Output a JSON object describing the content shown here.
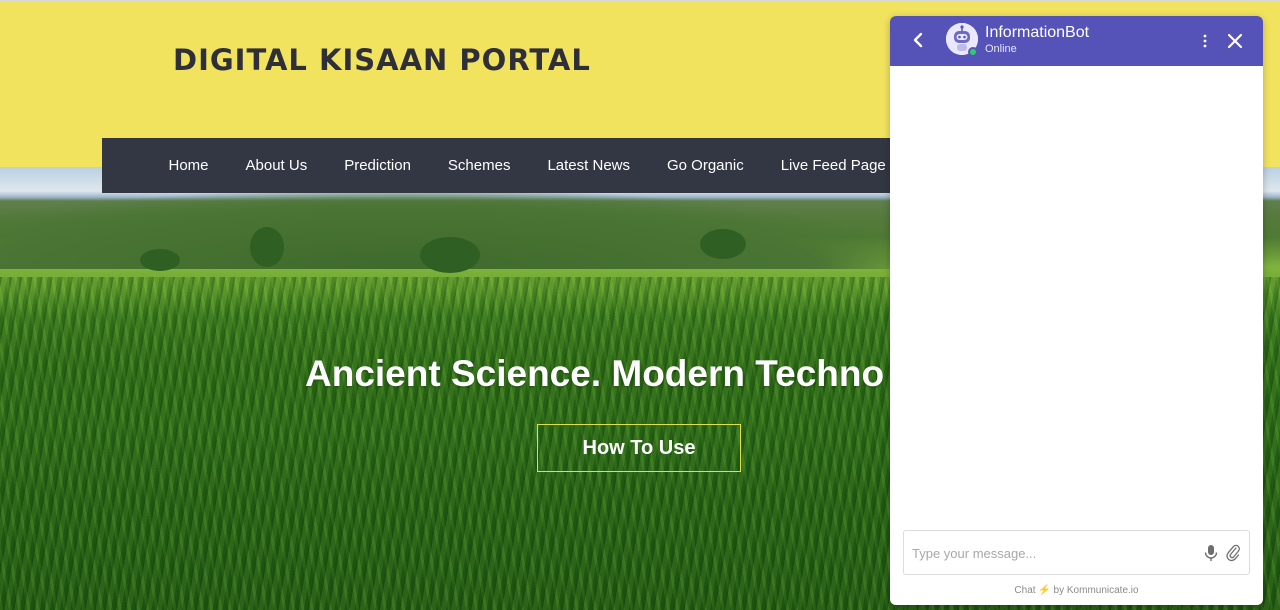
{
  "site": {
    "title": "DIGITAL KISAAN PORTAL"
  },
  "nav": {
    "items": [
      "Home",
      "About Us",
      "Prediction",
      "Schemes",
      "Latest News",
      "Go Organic",
      "Live Feed Page"
    ]
  },
  "hero": {
    "heading": "Ancient Science. Modern Techno",
    "button_label": "How To Use"
  },
  "chat": {
    "bot_name": "InformationBot",
    "status": "Online",
    "input_placeholder": "Type your message...",
    "footer_prefix": "Chat",
    "footer_suffix": "by Kommunicate.io",
    "colors": {
      "header": "#5553b7",
      "online": "#2ecc71"
    },
    "icons": [
      "back-icon",
      "bot-avatar-icon",
      "kebab-menu-icon",
      "close-icon",
      "mic-icon",
      "paperclip-icon",
      "bolt-icon"
    ]
  },
  "colors": {
    "header_bg": "#f2e35e",
    "nav_bg": "#333743",
    "button_border": "#e0e04a"
  }
}
